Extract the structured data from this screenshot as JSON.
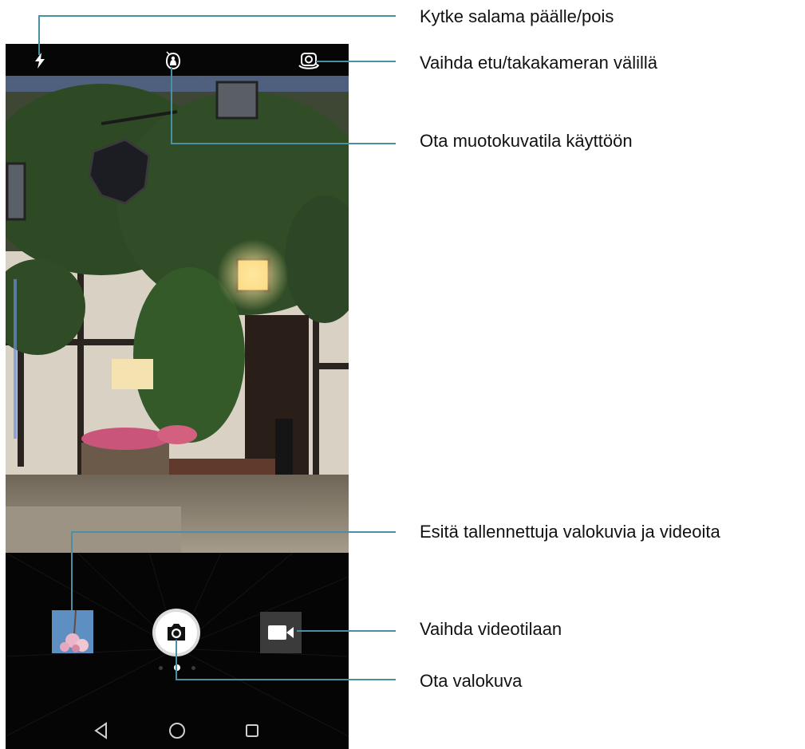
{
  "callouts": {
    "flash": "Kytke salama päälle/pois",
    "switch_camera": "Vaihda etu/takakameran välillä",
    "portrait": "Ota muotokuvatila käyttöön",
    "gallery": "Esitä tallennettuja valokuvia ja videoita",
    "video": "Vaihda videotilaan",
    "capture": "Ota valokuva"
  },
  "icons": {
    "flash": "flash-icon",
    "portrait": "portrait-mode-icon",
    "switch_camera": "switch-camera-icon",
    "gallery": "gallery-thumbnail",
    "shutter": "camera-shutter-icon",
    "video": "video-camera-icon",
    "nav_back": "back-triangle-icon",
    "nav_home": "home-circle-icon",
    "nav_recents": "recents-square-icon"
  },
  "mode_pager": {
    "pages": 3,
    "active_page": 2
  },
  "colors": {
    "leader_line": "#4a8fa3",
    "ui_background": "#000000",
    "icon": "#ffffff",
    "video_button": "#3b3b3b"
  }
}
